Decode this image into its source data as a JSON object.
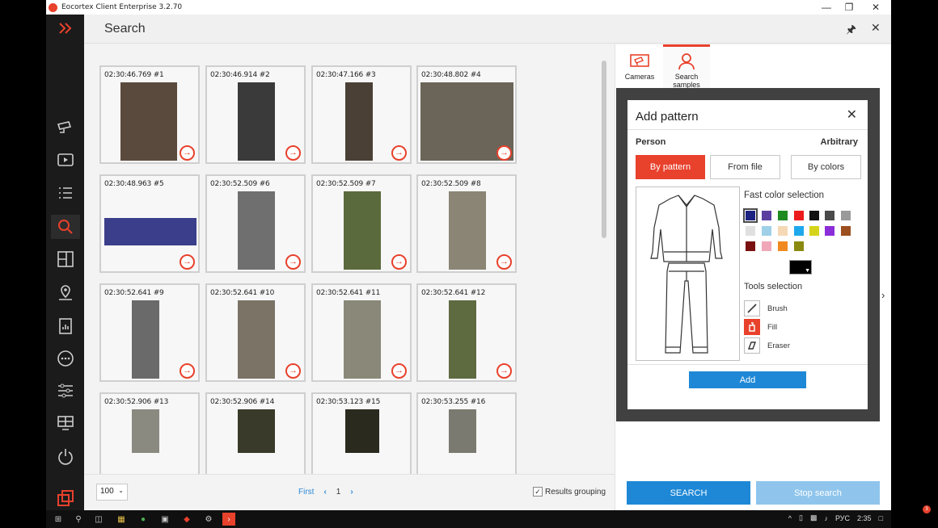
{
  "window": {
    "title": "Eocortex Client Enterprise 3.2.70",
    "controls": [
      "—",
      "❐",
      "✕"
    ]
  },
  "sidebar": {
    "items": [
      {
        "icon": "expand-icon"
      },
      {
        "icon": "camera-icon"
      },
      {
        "icon": "video-archive-icon"
      },
      {
        "icon": "event-list-icon"
      },
      {
        "icon": "search-icon",
        "active": true
      },
      {
        "icon": "layout-icon"
      },
      {
        "icon": "map-icon"
      },
      {
        "icon": "reports-icon"
      },
      {
        "icon": "more-icon"
      },
      {
        "icon": "settings-icon"
      },
      {
        "icon": "monitor-icon"
      },
      {
        "icon": "power-icon"
      },
      {
        "icon": "brand-logo-icon"
      }
    ]
  },
  "header": {
    "title": "Search",
    "pin_icon": "pin-icon",
    "close_icon": "close-icon"
  },
  "results": [
    {
      "timestamp": "02:30:46.769 #1"
    },
    {
      "timestamp": "02:30:46.914 #2"
    },
    {
      "timestamp": "02:30:47.166 #3"
    },
    {
      "timestamp": "02:30:48.802 #4"
    },
    {
      "timestamp": "02:30:48.963 #5"
    },
    {
      "timestamp": "02:30:52.509 #6"
    },
    {
      "timestamp": "02:30:52.509 #7"
    },
    {
      "timestamp": "02:30:52.509 #8"
    },
    {
      "timestamp": "02:30:52.641 #9"
    },
    {
      "timestamp": "02:30:52.641 #10"
    },
    {
      "timestamp": "02:30:52.641 #11"
    },
    {
      "timestamp": "02:30:52.641 #12"
    },
    {
      "timestamp": "02:30:52.906 #13"
    },
    {
      "timestamp": "02:30:52.906 #14"
    },
    {
      "timestamp": "02:30:53.123 #15"
    },
    {
      "timestamp": "02:30:53.255 #16"
    }
  ],
  "pagination": {
    "per_page": "100",
    "first": "First",
    "prev": "‹",
    "page": "1",
    "next": "›"
  },
  "grouping": {
    "label": "Results grouping",
    "checked": true
  },
  "right_tabs": [
    {
      "label": "Cameras",
      "active": false
    },
    {
      "label": "Search samples",
      "active": true
    }
  ],
  "dialog": {
    "title": "Add pattern",
    "close": "✕",
    "object_type": "Person",
    "mode": "Arbitrary",
    "modes": [
      {
        "label": "By pattern",
        "active": true
      },
      {
        "label": "From file",
        "active": false
      },
      {
        "label": "By colors",
        "active": false
      }
    ],
    "fast_color_label": "Fast color selection",
    "colors": [
      "#1c2380",
      "#5b3fa0",
      "#1f8a1f",
      "#ec1c1c",
      "#111111",
      "#4a4a4a",
      "#9a9a9a",
      "#e0e0e0",
      "#9fd0e8",
      "#f5d9b5",
      "#1ea8ec",
      "#d6d41a",
      "#8b2ed8",
      "#9c4f1f",
      "#7a1010",
      "#f0a8b8",
      "#f08a20",
      "#8a8a10"
    ],
    "selected_color": "#1c2380",
    "current_color": "#000000",
    "tools_label": "Tools selection",
    "tools": [
      {
        "label": "Brush",
        "icon": "brush-icon",
        "active": false
      },
      {
        "label": "Fill",
        "icon": "fill-bucket-icon",
        "active": true
      },
      {
        "label": "Eraser",
        "icon": "eraser-icon",
        "active": false
      }
    ],
    "add_label": "Add"
  },
  "actions": {
    "search": "SEARCH",
    "stop": "Stop search"
  },
  "taskbar": {
    "language": "РУС",
    "time": "2:35"
  },
  "notification_badge": "3"
}
